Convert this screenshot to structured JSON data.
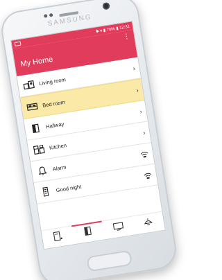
{
  "device": {
    "brand": "SAMSUNG"
  },
  "status": {
    "right": "✱ ▾ ▮ 76% ▮ 12:31"
  },
  "appbar": {
    "title": "My Home",
    "menu": "⋮"
  },
  "rooms": [
    {
      "label": "Living room",
      "icon": "living-room-icon",
      "trail": "›",
      "trail_icon": "chevron-right-icon",
      "selected": false
    },
    {
      "label": "Bed room",
      "icon": "bed-icon",
      "trail": "›",
      "trail_icon": "chevron-right-icon",
      "selected": true
    },
    {
      "label": "Hallway",
      "icon": "door-icon",
      "trail": "›",
      "trail_icon": "chevron-right-icon",
      "selected": false
    },
    {
      "label": "Kitchen",
      "icon": "kitchen-icon",
      "trail": "›",
      "trail_icon": "chevron-right-icon",
      "selected": false
    },
    {
      "label": "Alarm",
      "icon": "bell-icon",
      "trail": "",
      "trail_icon": "wireless-icon",
      "selected": false
    },
    {
      "label": "Good night",
      "icon": "remote-icon",
      "trail": "",
      "trail_icon": "wireless-icon",
      "selected": false
    }
  ],
  "bottom_nav": [
    {
      "icon": "device-icon",
      "active": false
    },
    {
      "icon": "door-icon",
      "active": true
    },
    {
      "icon": "tv-icon",
      "active": false
    },
    {
      "icon": "lamp-icon",
      "active": false
    }
  ],
  "colors": {
    "accent": "#e23c5c",
    "selected_bg": "#fbe9a8"
  }
}
